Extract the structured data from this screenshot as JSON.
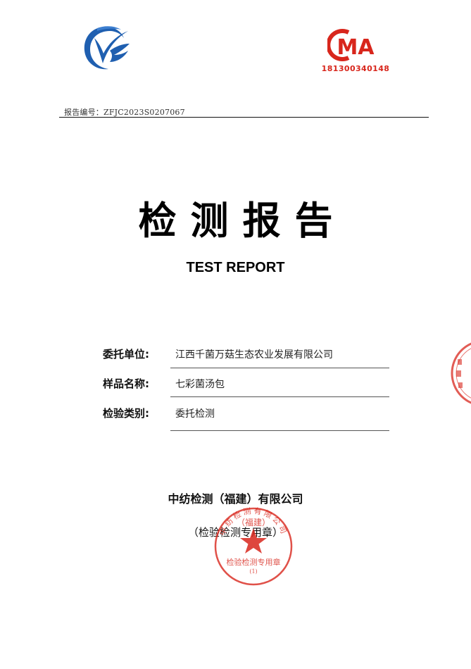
{
  "header": {
    "ma_mark_text": "MA",
    "ma_number": "181300340148",
    "report_number": "报告编号：ZFJC2023S0207067"
  },
  "title": {
    "main": "检测报告",
    "english": "TEST REPORT"
  },
  "fields": [
    {
      "label": "委托单位:",
      "value": "江西千菌万菇生态农业发展有限公司"
    },
    {
      "label": "样品名称:",
      "value": "七彩菌汤包"
    },
    {
      "label": "检验类别:",
      "value": "委托检测"
    }
  ],
  "footer": {
    "company": "中纺检测（福建）有限公司",
    "seal_note": "（检验检测专用章）"
  },
  "stamp": {
    "top_text": "（福建）",
    "ring_text": "中纺检测有限公司",
    "middle_text": "检验检测专用章",
    "bottom_text": "(1)",
    "color": "#d8261c"
  },
  "colors": {
    "logo_blue": "#1f5fb0",
    "seal_red": "#d8261c",
    "rule": "#111111"
  }
}
